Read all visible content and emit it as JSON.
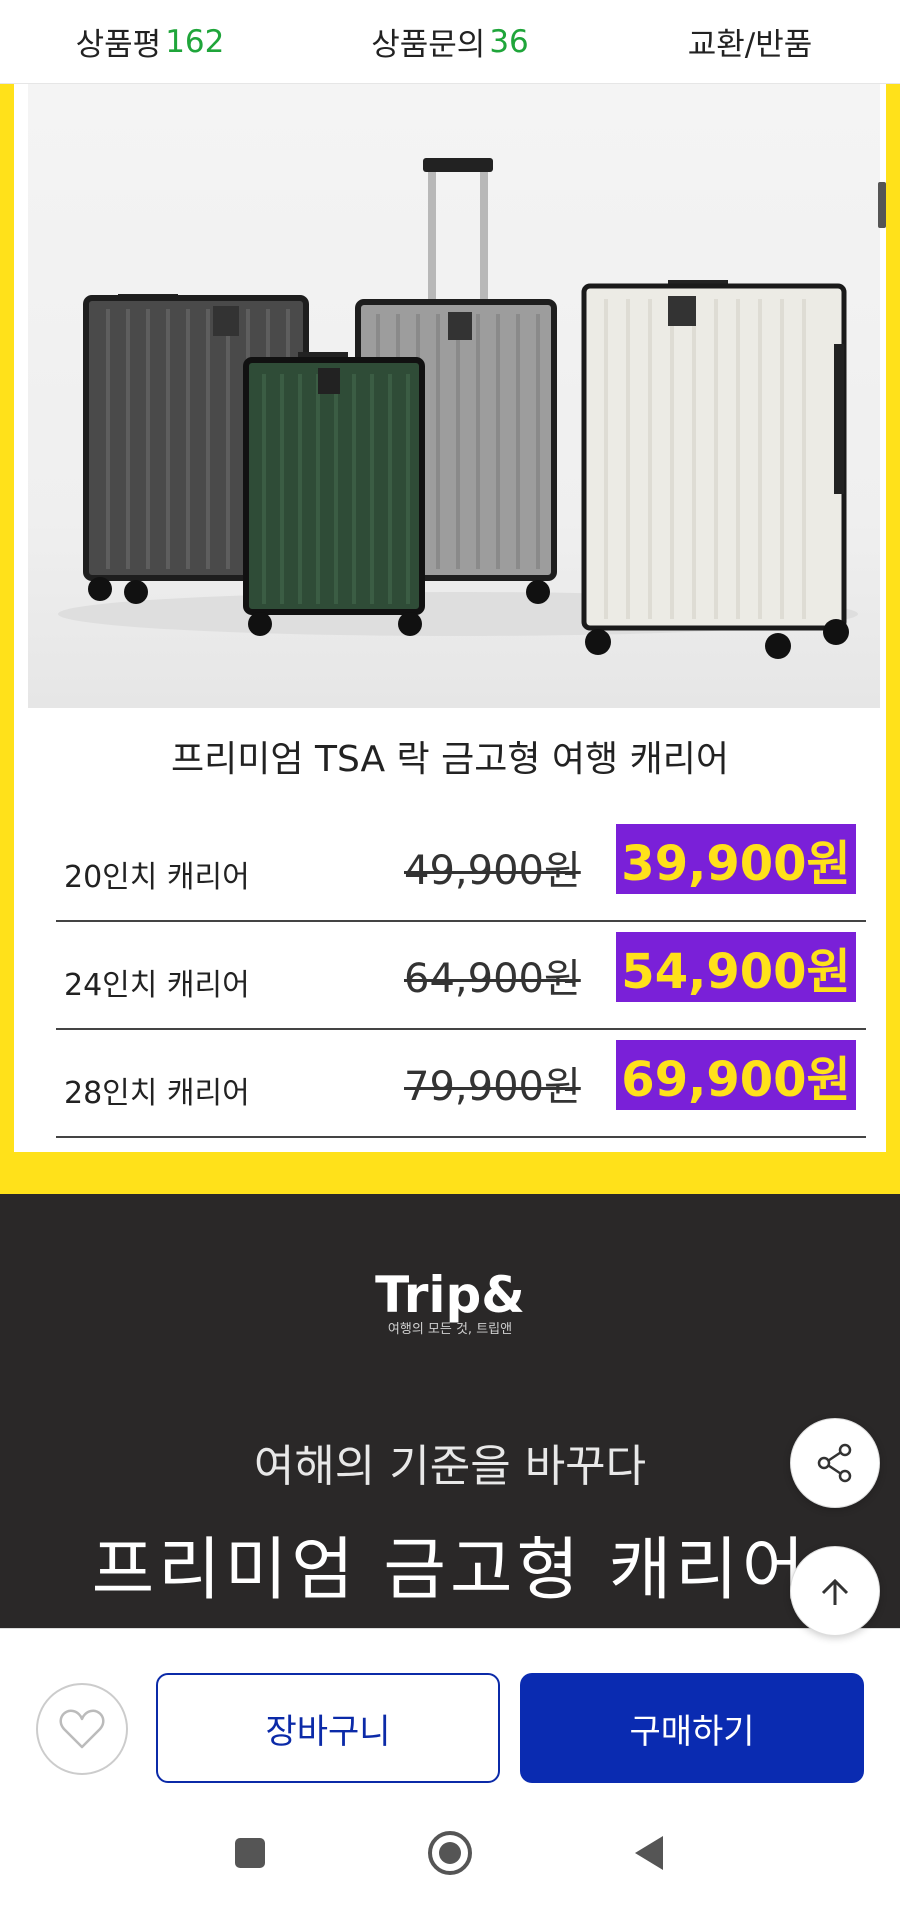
{
  "tabs": [
    {
      "label": "상품평",
      "count": "162"
    },
    {
      "label": "상품문의",
      "count": "36"
    },
    {
      "label": "교환/반품",
      "count": ""
    }
  ],
  "product": {
    "title": "프리미엄 TSA 락 금고형 여행 캐리어",
    "prices": [
      {
        "size": "20인치 캐리어",
        "original": "49,900원",
        "sale": "39,900원"
      },
      {
        "size": "24인치 캐리어",
        "original": "64,900원",
        "sale": "54,900원"
      },
      {
        "size": "28인치 캐리어",
        "original": "79,900원",
        "sale": "69,900원"
      }
    ]
  },
  "banner": {
    "logo": "Trip&",
    "logo_sub": "여행의 모든 것, 트립앤",
    "subtitle": "여해의 기준을 바꾸다",
    "title": "프리미엄 금고형 캐리어"
  },
  "actions": {
    "cart_label": "장바구니",
    "buy_label": "구매하기"
  },
  "colors": {
    "accent_yellow": "#ffe11a",
    "sale_bg": "#7a20d8",
    "brand_blue": "#0a2bb1",
    "count_green": "#1fa53a"
  }
}
